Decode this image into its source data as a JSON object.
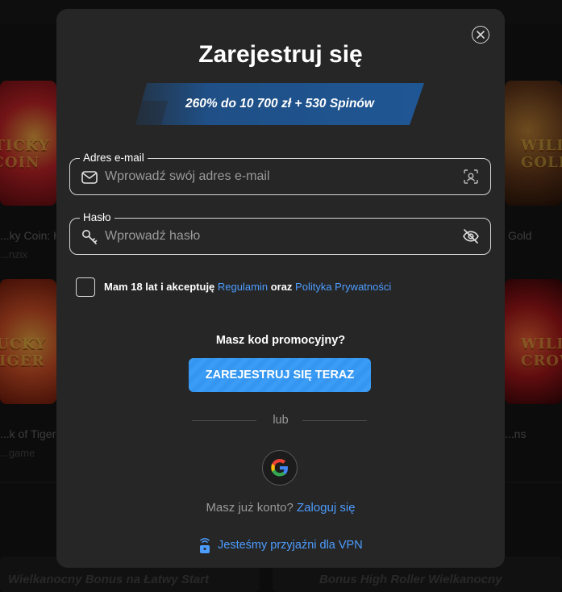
{
  "background": {
    "games": [
      {
        "title": "...ky Coin: H",
        "provider": "...nzix"
      },
      {
        "title": "Gold",
        "provider": ""
      },
      {
        "title": "...k of Tiger",
        "provider": "...game"
      },
      {
        "title": "...ns",
        "provider": ""
      }
    ],
    "tile_art": [
      "STICKY COIN",
      "WILD GOLD",
      "LUCKY TIGER",
      "WILD CROWNS"
    ],
    "banners": [
      "Wielkanocny Bonus na Łatwy Start",
      "Bonus High Roller Wielkanocny"
    ]
  },
  "modal": {
    "title": "Zarejestruj się",
    "promo_banner": "260% do 10 700 zł + 530 Spinów",
    "email": {
      "label": "Adres e-mail",
      "placeholder": "Wprowadź swój adres e-mail",
      "value": ""
    },
    "password": {
      "label": "Hasło",
      "placeholder": "Wprowadź hasło",
      "value": ""
    },
    "terms": {
      "prefix": "Mam 18 lat i akceptuję",
      "link1": "Regulamin",
      "middle": "oraz",
      "link2": "Polityka Prywatności",
      "checked": false
    },
    "promo_code_label": "Masz kod promocyjny?",
    "submit_label": "ZAREJESTRUJ SIĘ TERAZ",
    "divider_text": "lub",
    "login_prompt": "Masz już konto?",
    "login_link": "Zaloguj się",
    "vpn_text": "Jesteśmy przyjaźni dla VPN"
  },
  "colors": {
    "accent": "#4d9cff",
    "button": "#3496f0",
    "modal_bg": "#262626",
    "promo_bg": "#1f4f86"
  }
}
